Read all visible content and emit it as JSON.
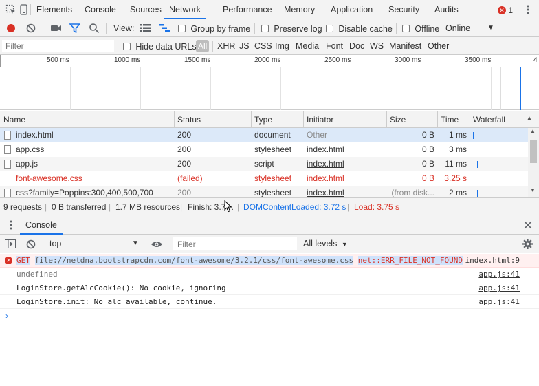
{
  "tabs": {
    "elements": "Elements",
    "console": "Console",
    "sources": "Sources",
    "network": "Network",
    "performance": "Performance",
    "memory": "Memory",
    "application": "Application",
    "security": "Security",
    "audits": "Audits",
    "error_count": "1"
  },
  "toolbar": {
    "view_label": "View:",
    "group_by_frame": "Group by frame",
    "preserve_log": "Preserve log",
    "disable_cache": "Disable cache",
    "offline": "Offline",
    "throttling": "Online"
  },
  "filterbar": {
    "placeholder": "Filter",
    "hide_data_urls": "Hide data URLs",
    "types": [
      "All",
      "XHR",
      "JS",
      "CSS",
      "Img",
      "Media",
      "Font",
      "Doc",
      "WS",
      "Manifest",
      "Other"
    ]
  },
  "overview": {
    "ticks": [
      "500 ms",
      "1000 ms",
      "1500 ms",
      "2000 ms",
      "2500 ms",
      "3000 ms",
      "3500 ms",
      "4"
    ]
  },
  "table": {
    "headers": [
      "Name",
      "Status",
      "Type",
      "Initiator",
      "Size",
      "Time",
      "Waterfall"
    ],
    "rows": [
      {
        "name": "index.html",
        "status": "200",
        "type": "document",
        "initiator": "Other",
        "size": "0 B",
        "time": "1 ms",
        "failed": false
      },
      {
        "name": "app.css",
        "status": "200",
        "type": "stylesheet",
        "initiator": "index.html",
        "size": "0 B",
        "time": "3 ms",
        "failed": false
      },
      {
        "name": "app.js",
        "status": "200",
        "type": "script",
        "initiator": "index.html",
        "size": "0 B",
        "time": "11 ms",
        "failed": false
      },
      {
        "name": "font-awesome.css",
        "status": "(failed)",
        "type": "stylesheet",
        "initiator": "index.html",
        "size": "0 B",
        "time": "3.25 s",
        "failed": true
      },
      {
        "name": "css?family=Poppins:300,400,500,700",
        "status": "200",
        "type": "stylesheet",
        "initiator": "index.html",
        "size": "(from disk...",
        "time": "2 ms",
        "failed": false
      }
    ]
  },
  "summary": {
    "requests": "9 requests",
    "transferred": "0 B transferred",
    "resources": "1.7 MB resources",
    "finish": "Finish: 3.7…",
    "dom_content_loaded": "DOMContentLoaded: 3.72 s",
    "load": "Load: 3.75 s"
  },
  "drawer": {
    "title": "Console"
  },
  "console_toolbar": {
    "context": "top",
    "filter_placeholder": "Filter",
    "levels": "All levels"
  },
  "console": {
    "error": {
      "method": "GET",
      "url": "file://netdna.bootstrapcdn.com/font-awesome/3.2.1/css/font-awesome.css",
      "code": "net::ERR_FILE_NOT_FOUND",
      "source": "index.html:9"
    },
    "messages": [
      {
        "text": "undefined",
        "source": "app.js:41"
      },
      {
        "text": "LoginStore.getAlcCookie(): No cookie, ignoring",
        "source": "app.js:41"
      },
      {
        "text": "LoginStore.init: No alc available, continue.",
        "source": "app.js:41"
      }
    ]
  },
  "colors": {
    "accent": "#1a73e8",
    "error": "#d93025",
    "record": "#d93025"
  }
}
